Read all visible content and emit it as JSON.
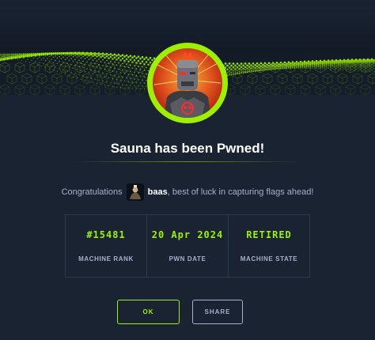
{
  "banner": {
    "accent_color": "#9fef00"
  },
  "machine": {
    "avatar_icon": "machine-avatar-robot"
  },
  "title": "Sauna has been Pwned!",
  "congrats": {
    "prefix": "Congratulations",
    "username": "baas",
    "suffix": ", best of luck in capturing flags ahead!"
  },
  "stats": [
    {
      "value": "#15481",
      "label": "MACHINE RANK"
    },
    {
      "value": "20 Apr 2024",
      "label": "PWN DATE"
    },
    {
      "value": "RETIRED",
      "label": "MACHINE STATE"
    }
  ],
  "buttons": {
    "ok_label": "OK",
    "share_label": "SHARE"
  },
  "colors": {
    "background": "#1a2332",
    "accent": "#9fef00",
    "muted": "#a4b1cd"
  }
}
